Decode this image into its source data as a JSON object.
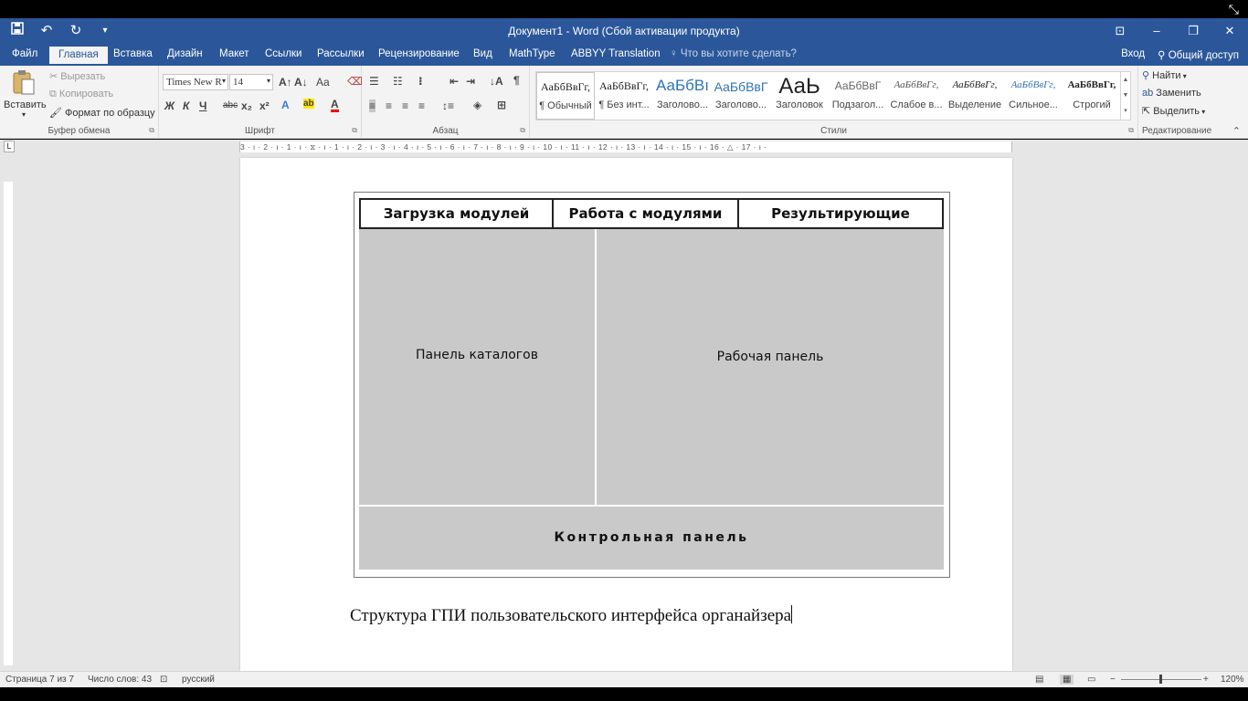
{
  "app": {
    "title": "Документ1 - Word (Сбой активации продукта)",
    "qat": {
      "save_icon": "save-icon",
      "undo_icon": "undo-icon",
      "redo_icon": "redo-icon",
      "customize_icon": "customize-icon"
    }
  },
  "window": {
    "restore_icon": "ribbon-display-icon",
    "minimize": "–",
    "maximize": "❐",
    "close": "✕",
    "fullscreen_exit": "⤡"
  },
  "tabs": [
    "Файл",
    "Главная",
    "Вставка",
    "Дизайн",
    "Макет",
    "Ссылки",
    "Рассылки",
    "Рецензирование",
    "Вид",
    "MathType",
    "ABBYY Translation"
  ],
  "tell_me": "Что вы хотите сделать?",
  "signin": "Вход",
  "share": "Общий доступ",
  "clipboard": {
    "paste": "Вставить",
    "cut": "Вырезать",
    "copy": "Копировать",
    "format_painter": "Формат по образцу",
    "label": "Буфер обмена"
  },
  "font": {
    "name": "Times New R",
    "size": "14",
    "bold": "Ж",
    "italic": "К",
    "underline": "Ч",
    "strike": "abc",
    "subscript": "x₂",
    "superscript": "x²",
    "grow": "A↑",
    "shrink": "A↓",
    "case": "Aa",
    "label": "Шрифт"
  },
  "paragraph": {
    "label": "Абзац",
    "pilcrow": "¶"
  },
  "styles": {
    "label": "Стили",
    "items": [
      {
        "preview": "АаБбВвГг,",
        "name": "¶ Обычный"
      },
      {
        "preview": "АаБбВвГг,",
        "name": "¶ Без инт..."
      },
      {
        "preview": "АаБбВı",
        "name": "Заголово..."
      },
      {
        "preview": "АаБбВвГ",
        "name": "Заголово..."
      },
      {
        "preview": "АаЬ",
        "name": "Заголовок"
      },
      {
        "preview": "АаБбВвГ",
        "name": "Подзагол..."
      },
      {
        "preview": "АаБбВвГг,",
        "name": "Слабое в..."
      },
      {
        "preview": "АаБбВвГг,",
        "name": "Выделение"
      },
      {
        "preview": "АаБбВвГг,",
        "name": "Сильное..."
      },
      {
        "preview": "АаБбВвГг,",
        "name": "Строгий"
      }
    ]
  },
  "editing": {
    "find": "Найти",
    "replace": "Заменить",
    "select": "Выделить",
    "label": "Редактирование"
  },
  "ruler": {
    "marks": "3 · ı · 2 · ı · 1 · ı · ⧖ · ı · 1 · ı · 2 · ı · 3 · ı · 4 · ı · 5 · ı · 6 · ı · 7 · ı · 8 · ı · 9 · ı · 10 · ı · 11 · ı · 12 · ı · 13 · ı · 14 · ı · 15 · ı · 16 · △ · 17 · ı ·"
  },
  "figure": {
    "headers": [
      "Загрузка модулей",
      "Работа с модулями",
      "Результирующие данные"
    ],
    "left_panel": "Панель каталогов",
    "work_panel": "Рабочая панель",
    "control_panel": "Контрольная панель"
  },
  "caption": "Структура ГПИ пользовательского интерфейса органайзера",
  "status": {
    "page": "Страница 7 из 7",
    "words": "Число слов: 43",
    "language": "русский",
    "zoom": "120%"
  }
}
